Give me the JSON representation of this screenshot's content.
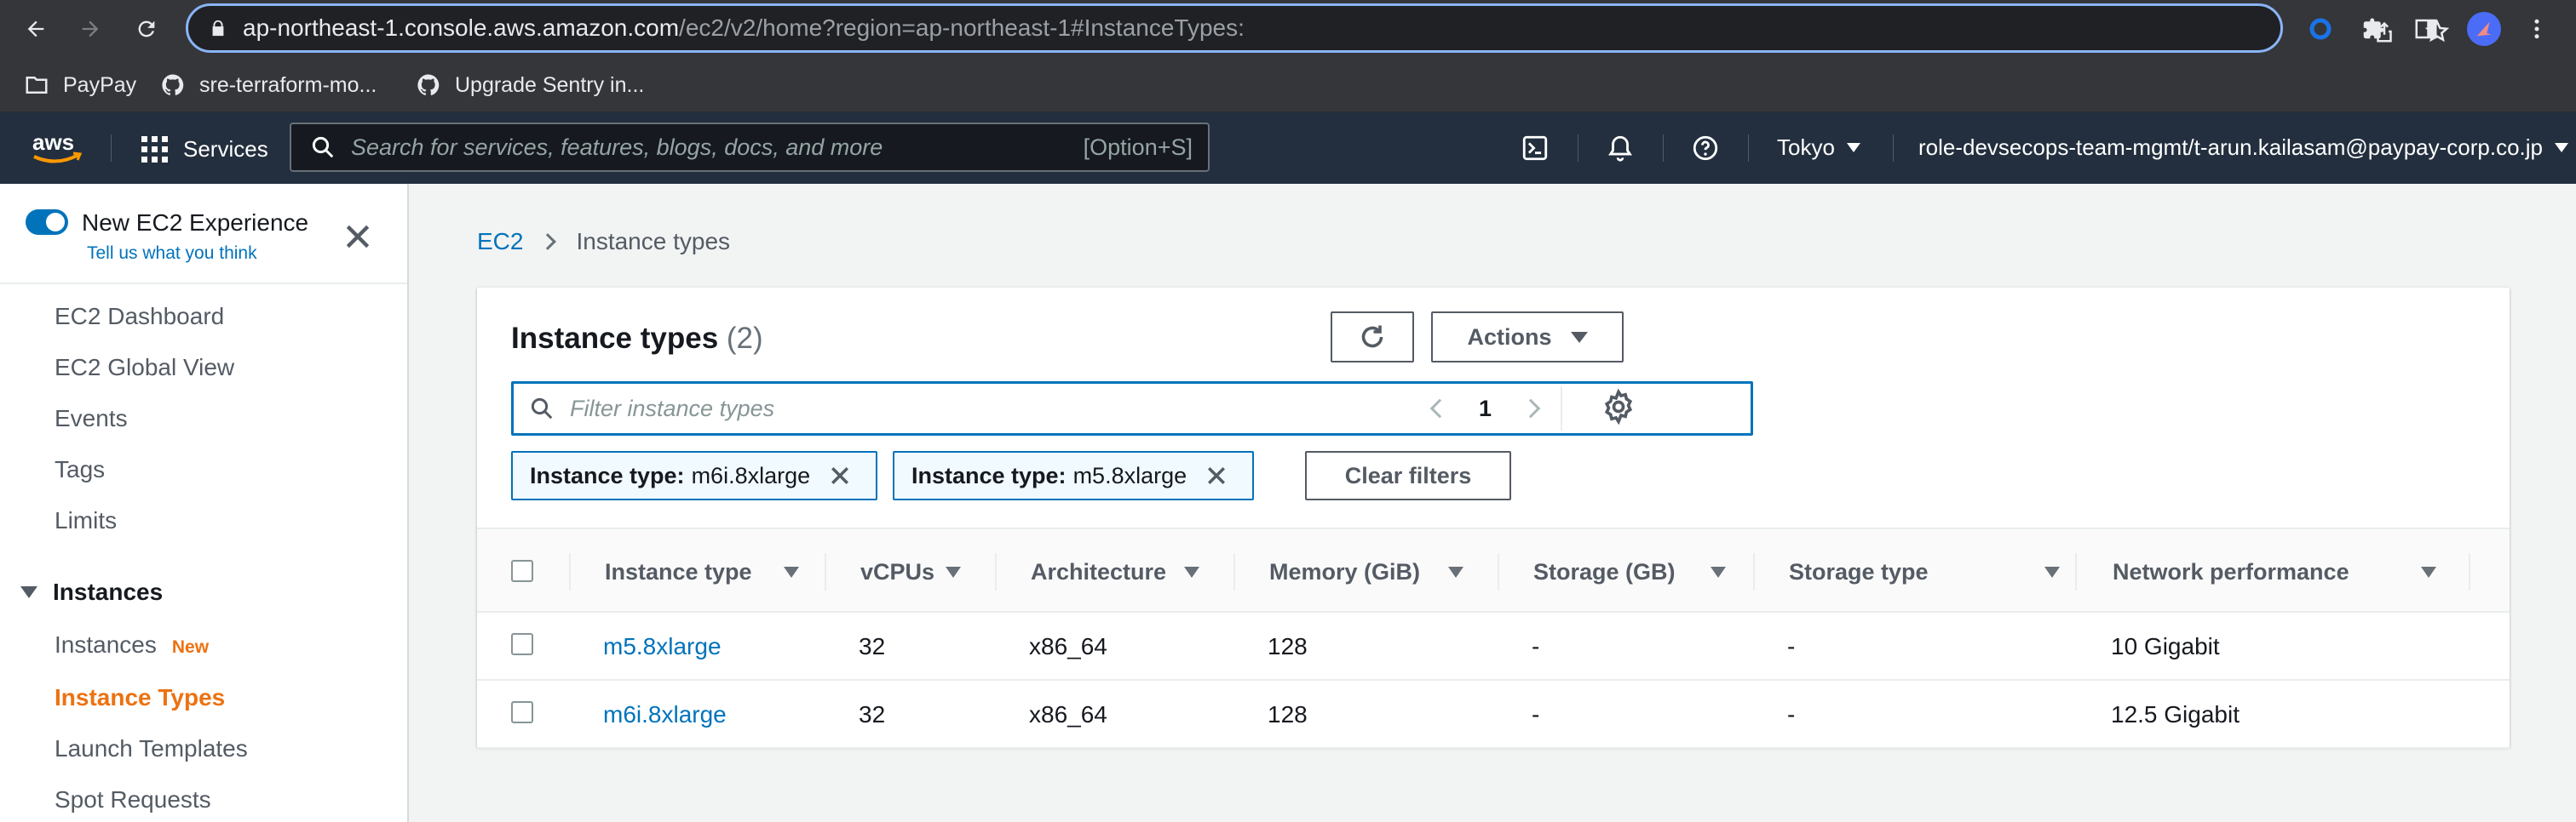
{
  "browser": {
    "url_host": "ap-northeast-1.console.aws.amazon.com",
    "url_path": "/ec2/v2/home?region=ap-northeast-1#InstanceTypes:",
    "bookmarks": [
      {
        "label": "PayPay",
        "icon": "folder-icon"
      },
      {
        "label": "sre-terraform-mo...",
        "icon": "github-icon"
      },
      {
        "label": "Upgrade Sentry in...",
        "icon": "github-icon"
      }
    ]
  },
  "aws_header": {
    "logo": "aws",
    "services_label": "Services",
    "search_placeholder": "Search for services, features, blogs, docs, and more",
    "search_shortcut": "[Option+S]",
    "region": "Tokyo",
    "account": "role-devsecops-team-mgmt/t-arun.kailasam@paypay-corp.co.jp"
  },
  "sidebar": {
    "new_experience_title": "New EC2 Experience",
    "new_experience_link": "Tell us what you think",
    "items_top": [
      "EC2 Dashboard",
      "EC2 Global View",
      "Events",
      "Tags",
      "Limits"
    ],
    "section_instances": "Instances",
    "instances_items": [
      {
        "label": "Instances",
        "badge": "New"
      },
      {
        "label": "Instance Types",
        "active": true
      },
      {
        "label": "Launch Templates"
      },
      {
        "label": "Spot Requests"
      }
    ]
  },
  "breadcrumb": {
    "root": "EC2",
    "current": "Instance types"
  },
  "panel": {
    "title": "Instance types",
    "count": "(2)",
    "actions_label": "Actions",
    "filter_placeholder": "Filter instance types",
    "page_number": "1",
    "tokens": [
      {
        "key": "Instance type:",
        "value": "m6i.8xlarge"
      },
      {
        "key": "Instance type:",
        "value": "m5.8xlarge"
      }
    ],
    "clear_filters_label": "Clear filters"
  },
  "table": {
    "columns": [
      "Instance type",
      "vCPUs",
      "Architecture",
      "Memory (GiB)",
      "Storage (GB)",
      "Storage type",
      "Network performance"
    ],
    "rows": [
      {
        "type": "m5.8xlarge",
        "vcpus": "32",
        "arch": "x86_64",
        "memory": "128",
        "storage": "-",
        "storage_type": "-",
        "network": "10 Gigabit"
      },
      {
        "type": "m6i.8xlarge",
        "vcpus": "32",
        "arch": "x86_64",
        "memory": "128",
        "storage": "-",
        "storage_type": "-",
        "network": "12.5 Gigabit"
      }
    ]
  },
  "colors": {
    "aws_header": "#232f3e",
    "link": "#0073bb",
    "active_nav": "#ec7211",
    "browser_chrome": "#35363a"
  }
}
